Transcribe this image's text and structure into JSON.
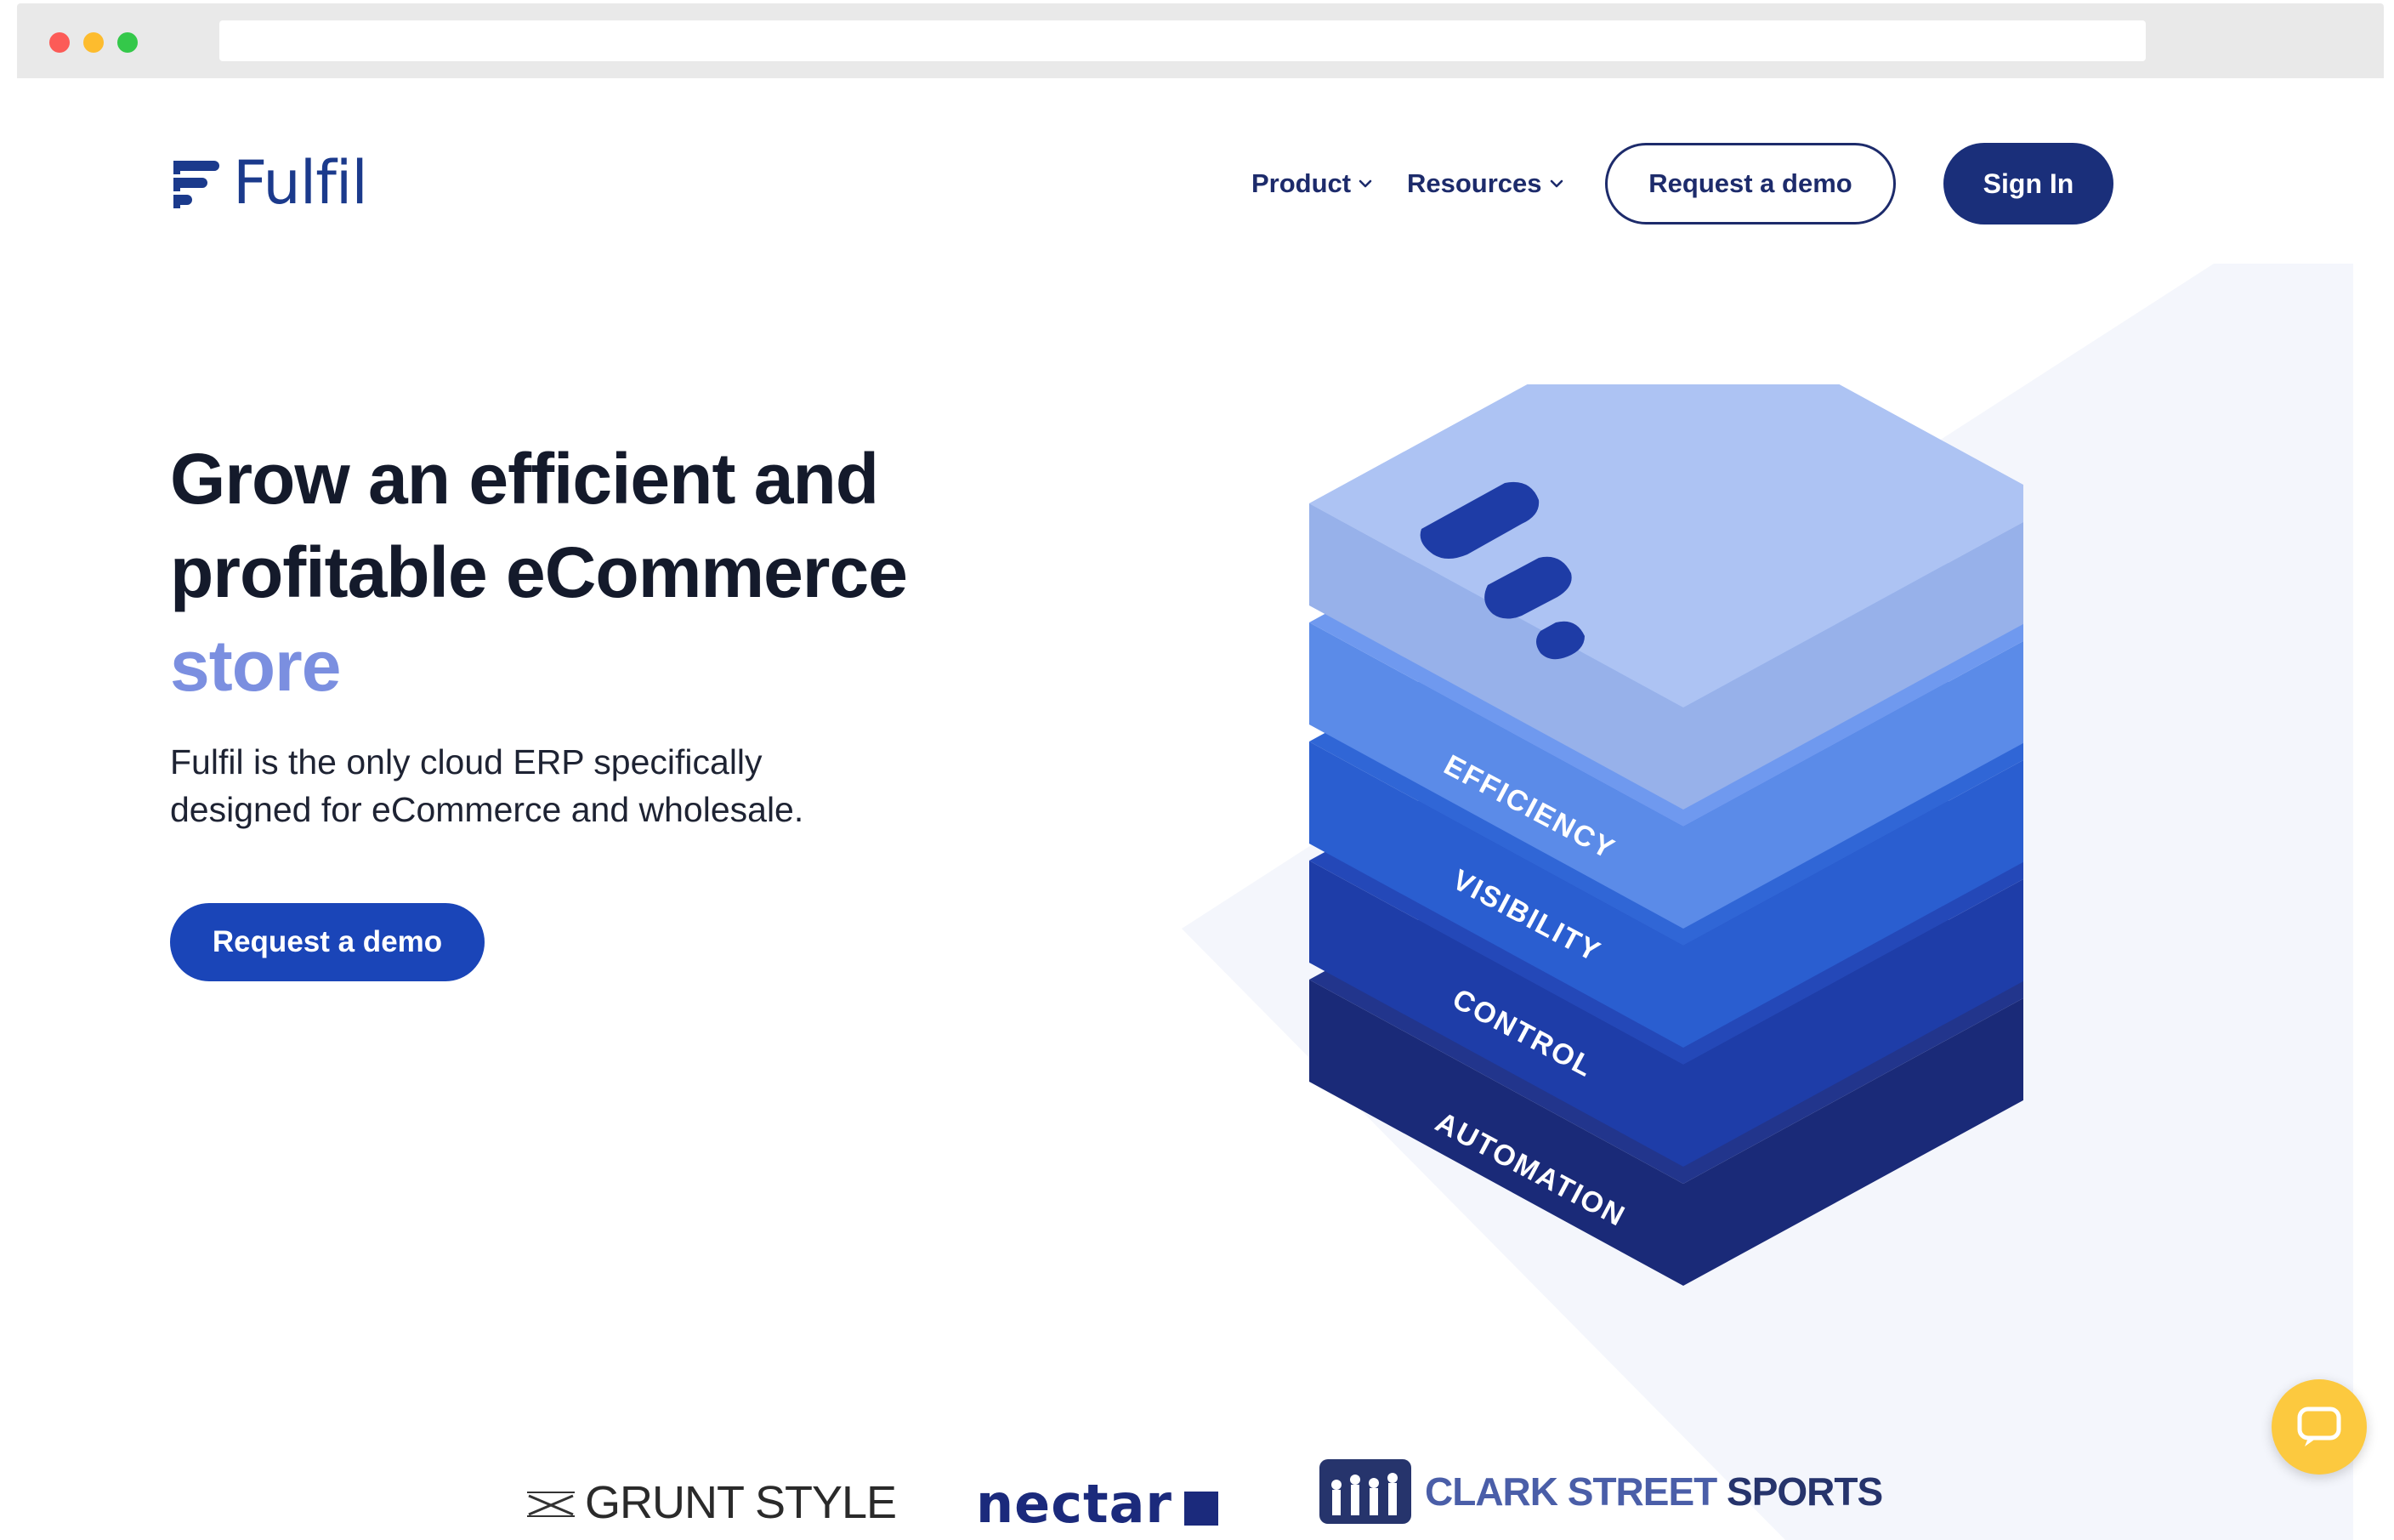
{
  "nav": {
    "brand": "Fulfil",
    "product_label": "Product",
    "resources_label": "Resources",
    "request_demo_label": "Request a demo",
    "sign_in_label": "Sign In"
  },
  "hero": {
    "title_line1": "Grow an efficient and",
    "title_line2": "profitable eCommerce",
    "title_accent": "store",
    "subtitle_line1": "Fulfil is the only cloud ERP specifically",
    "subtitle_line2": "designed for eCommerce and wholesale.",
    "cta_label": "Request a demo"
  },
  "illustration": {
    "layers": [
      "EFFICIENCY",
      "VISIBILITY",
      "CONTROL",
      "AUTOMATION"
    ]
  },
  "customers": {
    "grunt_style": "GRUNT STYLE",
    "nectar": "nectar",
    "clark_light": "CLARK STREET",
    "clark_dark": "SPORTS"
  },
  "colors": {
    "navy": "#1a2f7a",
    "primary_blue": "#1a45b8",
    "accent": "#7b8fe0",
    "chat": "#fcc93f"
  },
  "icons": {
    "nav_dropdown": "chevron-down-icon",
    "chat": "chat-bubble-icon"
  }
}
